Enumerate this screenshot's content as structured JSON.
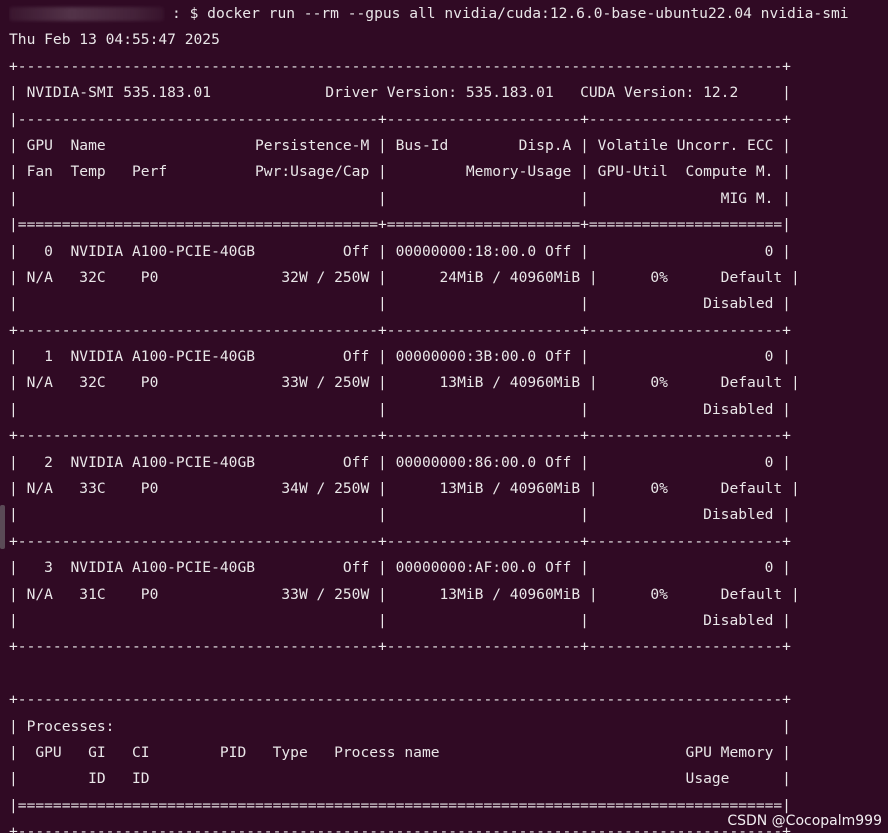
{
  "terminal": {
    "prompt": {
      "user": "",
      "suffix": ": $ "
    },
    "command": "docker run --rm --gpus all nvidia/cuda:12.6.0-base-ubuntu22.04 nvidia-smi",
    "output_lines": [
      "Thu Feb 13 04:55:47 2025",
      "+---------------------------------------------------------------------------------------+",
      "| NVIDIA-SMI 535.183.01             Driver Version: 535.183.01   CUDA Version: 12.2     |",
      "|-----------------------------------------+----------------------+----------------------+",
      "| GPU  Name                 Persistence-M | Bus-Id        Disp.A | Volatile Uncorr. ECC |",
      "| Fan  Temp   Perf          Pwr:Usage/Cap |         Memory-Usage | GPU-Util  Compute M. |",
      "|                                         |                      |               MIG M. |",
      "|=========================================+======================+======================|",
      "|   0  NVIDIA A100-PCIE-40GB          Off | 00000000:18:00.0 Off |                    0 |",
      "| N/A   32C    P0              32W / 250W |      24MiB / 40960MiB |      0%      Default |",
      "|                                         |                      |             Disabled |",
      "+-----------------------------------------+----------------------+----------------------+",
      "|   1  NVIDIA A100-PCIE-40GB          Off | 00000000:3B:00.0 Off |                    0 |",
      "| N/A   32C    P0              33W / 250W |      13MiB / 40960MiB |      0%      Default |",
      "|                                         |                      |             Disabled |",
      "+-----------------------------------------+----------------------+----------------------+",
      "|   2  NVIDIA A100-PCIE-40GB          Off | 00000000:86:00.0 Off |                    0 |",
      "| N/A   33C    P0              34W / 250W |      13MiB / 40960MiB |      0%      Default |",
      "|                                         |                      |             Disabled |",
      "+-----------------------------------------+----------------------+----------------------+",
      "|   3  NVIDIA A100-PCIE-40GB          Off | 00000000:AF:00.0 Off |                    0 |",
      "| N/A   31C    P0              33W / 250W |      13MiB / 40960MiB |      0%      Default |",
      "|                                         |                      |             Disabled |",
      "+-----------------------------------------+----------------------+----------------------+",
      "",
      "+---------------------------------------------------------------------------------------+",
      "| Processes:                                                                            |",
      "|  GPU   GI   CI        PID   Type   Process name                            GPU Memory |",
      "|        ID   ID                                                             Usage      |",
      "|=======================================================================================|",
      "+---------------------------------------------------------------------------------------+"
    ]
  },
  "watermark": "CSDN @Cocopalm999",
  "colors": {
    "background": "#300a24",
    "foreground": "#e9e6e8"
  }
}
